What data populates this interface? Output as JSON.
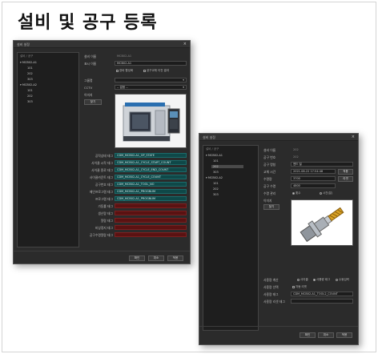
{
  "page_title": "설비 및 공구 등록",
  "win1": {
    "title": "설비 설정",
    "tree_header": "설비 / 공구",
    "tree": [
      "MCB02-A1",
      "101",
      "202",
      "303",
      "MCB02-A2",
      "101",
      "202",
      "303"
    ],
    "equip_name_label": "설비 이름",
    "equip_name_value": "MCB02-A1",
    "display_name_label": "표시 이름",
    "display_name_value": "MCB02-A1",
    "check_use": "장비 활성화",
    "check_auto": "공구교체 이전 결과",
    "group_label": "그룹명",
    "cctv_label": "CCTV",
    "cctv_value": "-- 없음 --",
    "image_label": "이미지",
    "image_button": "찾기",
    "tags": [
      {
        "label": "공작상태 태그",
        "value": "CDM_MCB02-A1_OP_STATE"
      },
      {
        "label": "사이클 시작 태그",
        "value": "CDM_MCB02-A1_CYCLE_START_COUNT"
      },
      {
        "label": "사이클 종료 태그",
        "value": "CDM_MCB02-A1_CYCLE_END_COUNT"
      },
      {
        "label": "사이클카운트 태그",
        "value": "CDM_MCB02-A1_CYCLE_COUNT"
      },
      {
        "label": "공구번호 태그",
        "value": "CDM_MCB02-A1_TOOL_NO"
      },
      {
        "label": "메인프로그램 태그",
        "value": "CDM_MCB02-A1_PROGNUM"
      },
      {
        "label": "프로그램 태그",
        "value": "CDM_MCB02-A1_PROGNUM"
      },
      {
        "label": "가동률 태그",
        "value": ""
      },
      {
        "label": "생산량 태그",
        "value": ""
      },
      {
        "label": "알람 태그",
        "value": ""
      },
      {
        "label": "비상정지 태그",
        "value": ""
      },
      {
        "label": "공구수명알람 태그",
        "value": ""
      }
    ],
    "ok": "확인",
    "cancel": "취소",
    "apply": "적용"
  },
  "win2": {
    "title": "설비 설정",
    "tree_header": "설비 / 공구",
    "tree": [
      "MCB02-A1",
      "101",
      "202",
      "303",
      "MCB02-A2",
      "101",
      "202",
      "303"
    ],
    "fields": [
      {
        "label": "설비 이름",
        "value": "202"
      },
      {
        "label": "공구 번호",
        "value": "202"
      },
      {
        "label": "공구 명칭",
        "value": "엔드 밀"
      },
      {
        "label": "교체 시간",
        "value": "2021-08-22 17:54:48"
      },
      {
        "label": "수명량",
        "value": "3700"
      },
      {
        "label": "공구 수명",
        "value": "4800"
      }
    ],
    "button_change": "적용",
    "button_reset": "리셋",
    "life_type_label": "수명 관리",
    "life_opt1": "횟수",
    "life_opt2": "시간(분)",
    "image_label": "이미지",
    "image_button": "찾기",
    "usage_label": "사용량 계산",
    "usage_opt1": "사이클",
    "usage_opt2": "사용량 태그",
    "usage_opt3": "수동입력",
    "usage_select_label": "사용량 선택",
    "usage_select_value": "자동 리셋",
    "usage_tag_label": "사용량 태그",
    "usage_tag_value": "CDM_MCB02-A1_TOOL2_COUNT",
    "manual_label": "사용량 리셋 태그",
    "ok": "확인",
    "cancel": "취소",
    "apply": "적용"
  }
}
